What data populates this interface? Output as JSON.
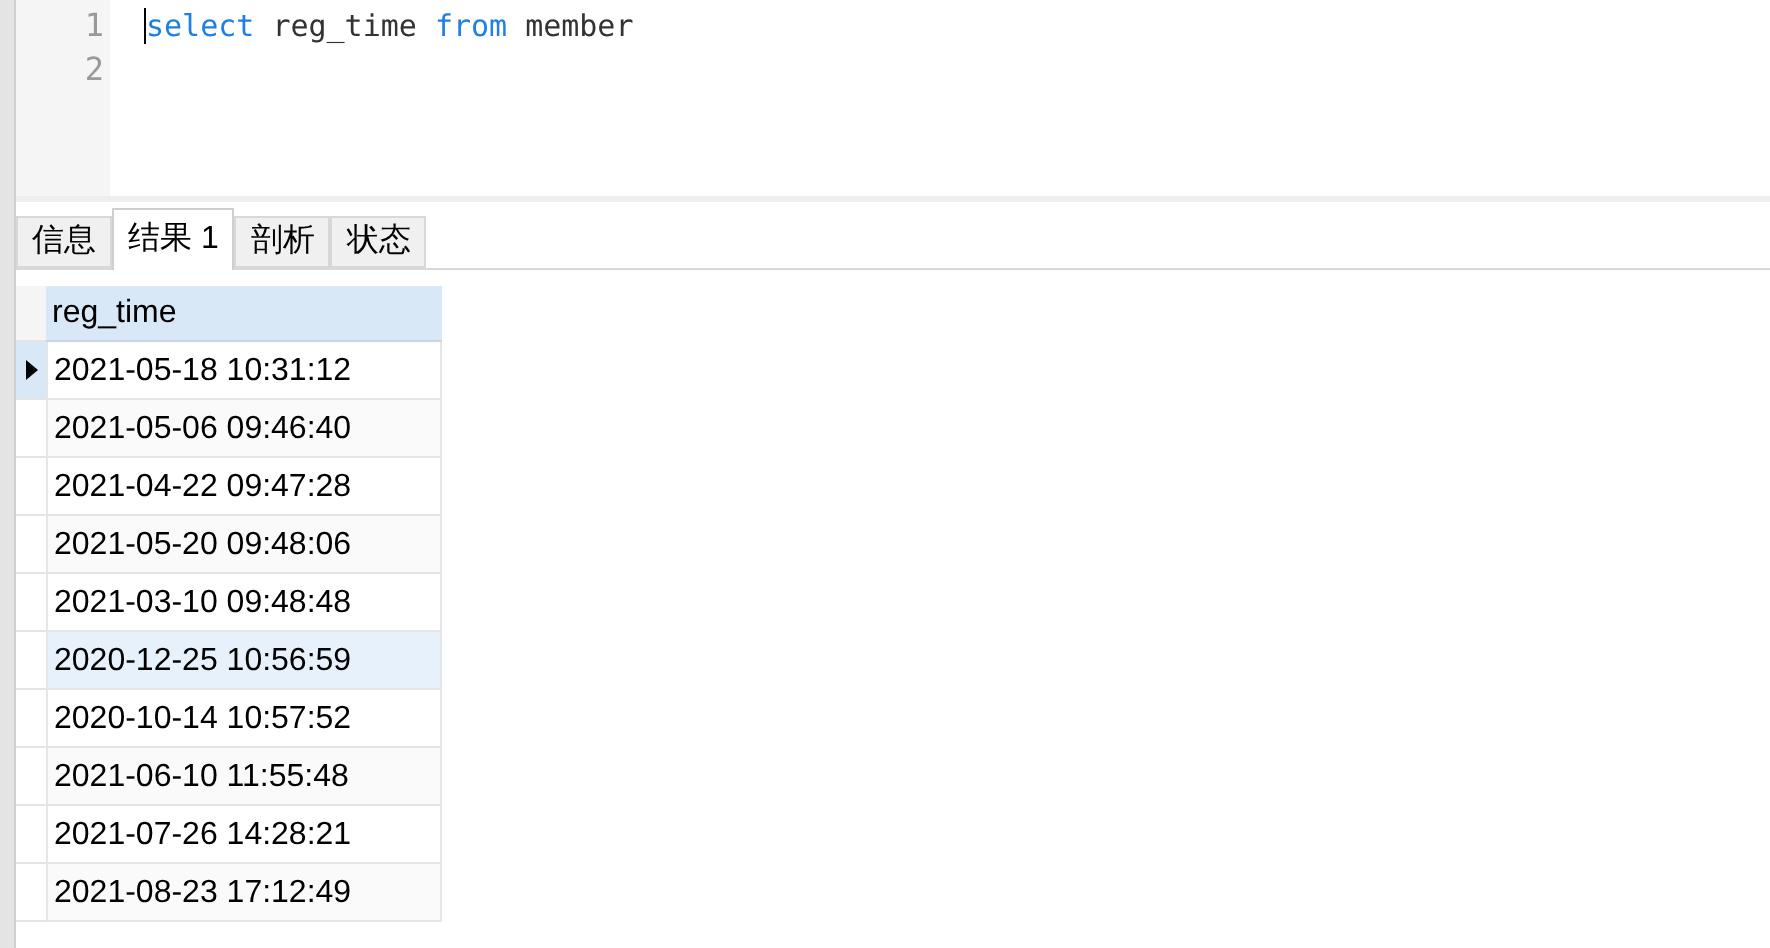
{
  "editor": {
    "lines": [
      {
        "number": "1",
        "tokens": [
          {
            "text": "select",
            "kind": "keyword"
          },
          {
            "text": "reg_time",
            "kind": "identifier"
          },
          {
            "text": "from",
            "kind": "keyword"
          },
          {
            "text": "member",
            "kind": "identifier"
          }
        ]
      },
      {
        "number": "2"
      }
    ]
  },
  "tabs": [
    {
      "label": "信息",
      "selected": false
    },
    {
      "label": "结果 1",
      "selected": true
    },
    {
      "label": "剖析",
      "selected": false
    },
    {
      "label": "状态",
      "selected": false
    }
  ],
  "table": {
    "columns": [
      "reg_time"
    ],
    "rows": [
      {
        "cells": [
          "2021-05-18 10:31:12"
        ],
        "selected": true,
        "hovered": false
      },
      {
        "cells": [
          "2021-05-06 09:46:40"
        ],
        "selected": false,
        "hovered": false
      },
      {
        "cells": [
          "2021-04-22 09:47:28"
        ],
        "selected": false,
        "hovered": false
      },
      {
        "cells": [
          "2021-05-20 09:48:06"
        ],
        "selected": false,
        "hovered": false
      },
      {
        "cells": [
          "2021-03-10 09:48:48"
        ],
        "selected": false,
        "hovered": false
      },
      {
        "cells": [
          "2020-12-25 10:56:59"
        ],
        "selected": false,
        "hovered": true
      },
      {
        "cells": [
          "2020-10-14 10:57:52"
        ],
        "selected": false,
        "hovered": false
      },
      {
        "cells": [
          "2021-06-10 11:55:48"
        ],
        "selected": false,
        "hovered": false
      },
      {
        "cells": [
          "2021-07-26 14:28:21"
        ],
        "selected": false,
        "hovered": false
      },
      {
        "cells": [
          "2021-08-23 17:12:49"
        ],
        "selected": false,
        "hovered": false
      }
    ]
  }
}
